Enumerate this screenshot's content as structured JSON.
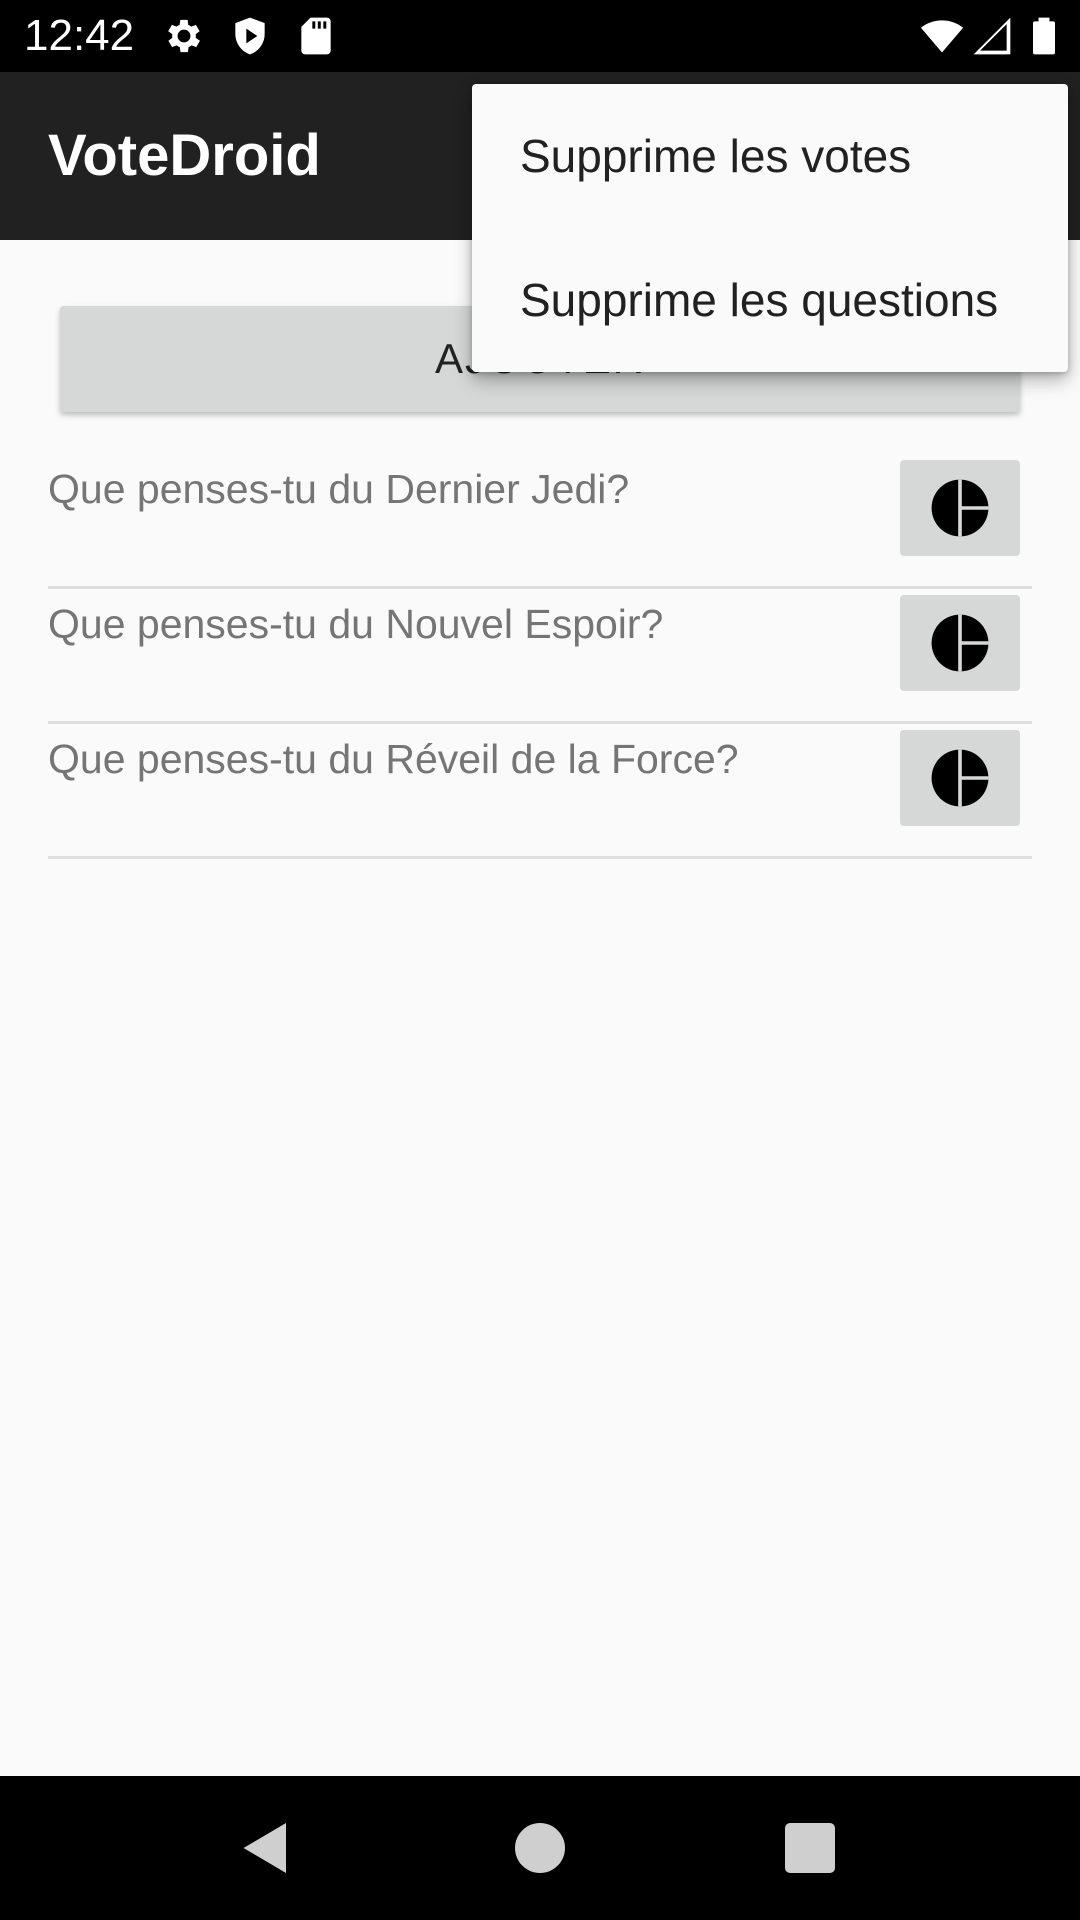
{
  "status_bar": {
    "time": "12:42",
    "icons": [
      "gear-icon",
      "shield-play-icon",
      "sd-card-icon",
      "wifi-icon",
      "cell-signal-icon",
      "battery-icon"
    ]
  },
  "app_bar": {
    "title": "VoteDroid"
  },
  "main": {
    "add_button_label": "AJOUTER",
    "questions": [
      {
        "text": "Que penses-tu du Dernier Jedi?",
        "action_icon": "pie-chart-icon"
      },
      {
        "text": "Que penses-tu du Nouvel Espoir?",
        "action_icon": "pie-chart-icon"
      },
      {
        "text": "Que penses-tu du Réveil de la Force?",
        "action_icon": "pie-chart-icon"
      }
    ]
  },
  "overflow_menu": {
    "items": [
      {
        "label": "Supprime les votes"
      },
      {
        "label": "Supprime les questions"
      }
    ]
  },
  "nav_bar": {
    "icons": [
      "back-icon",
      "home-icon",
      "recents-icon"
    ]
  },
  "colors": {
    "status_bar": "#000000",
    "app_bar": "#212121",
    "background": "#fafafa",
    "button": "#d6d7d7",
    "question_text": "#757575"
  }
}
